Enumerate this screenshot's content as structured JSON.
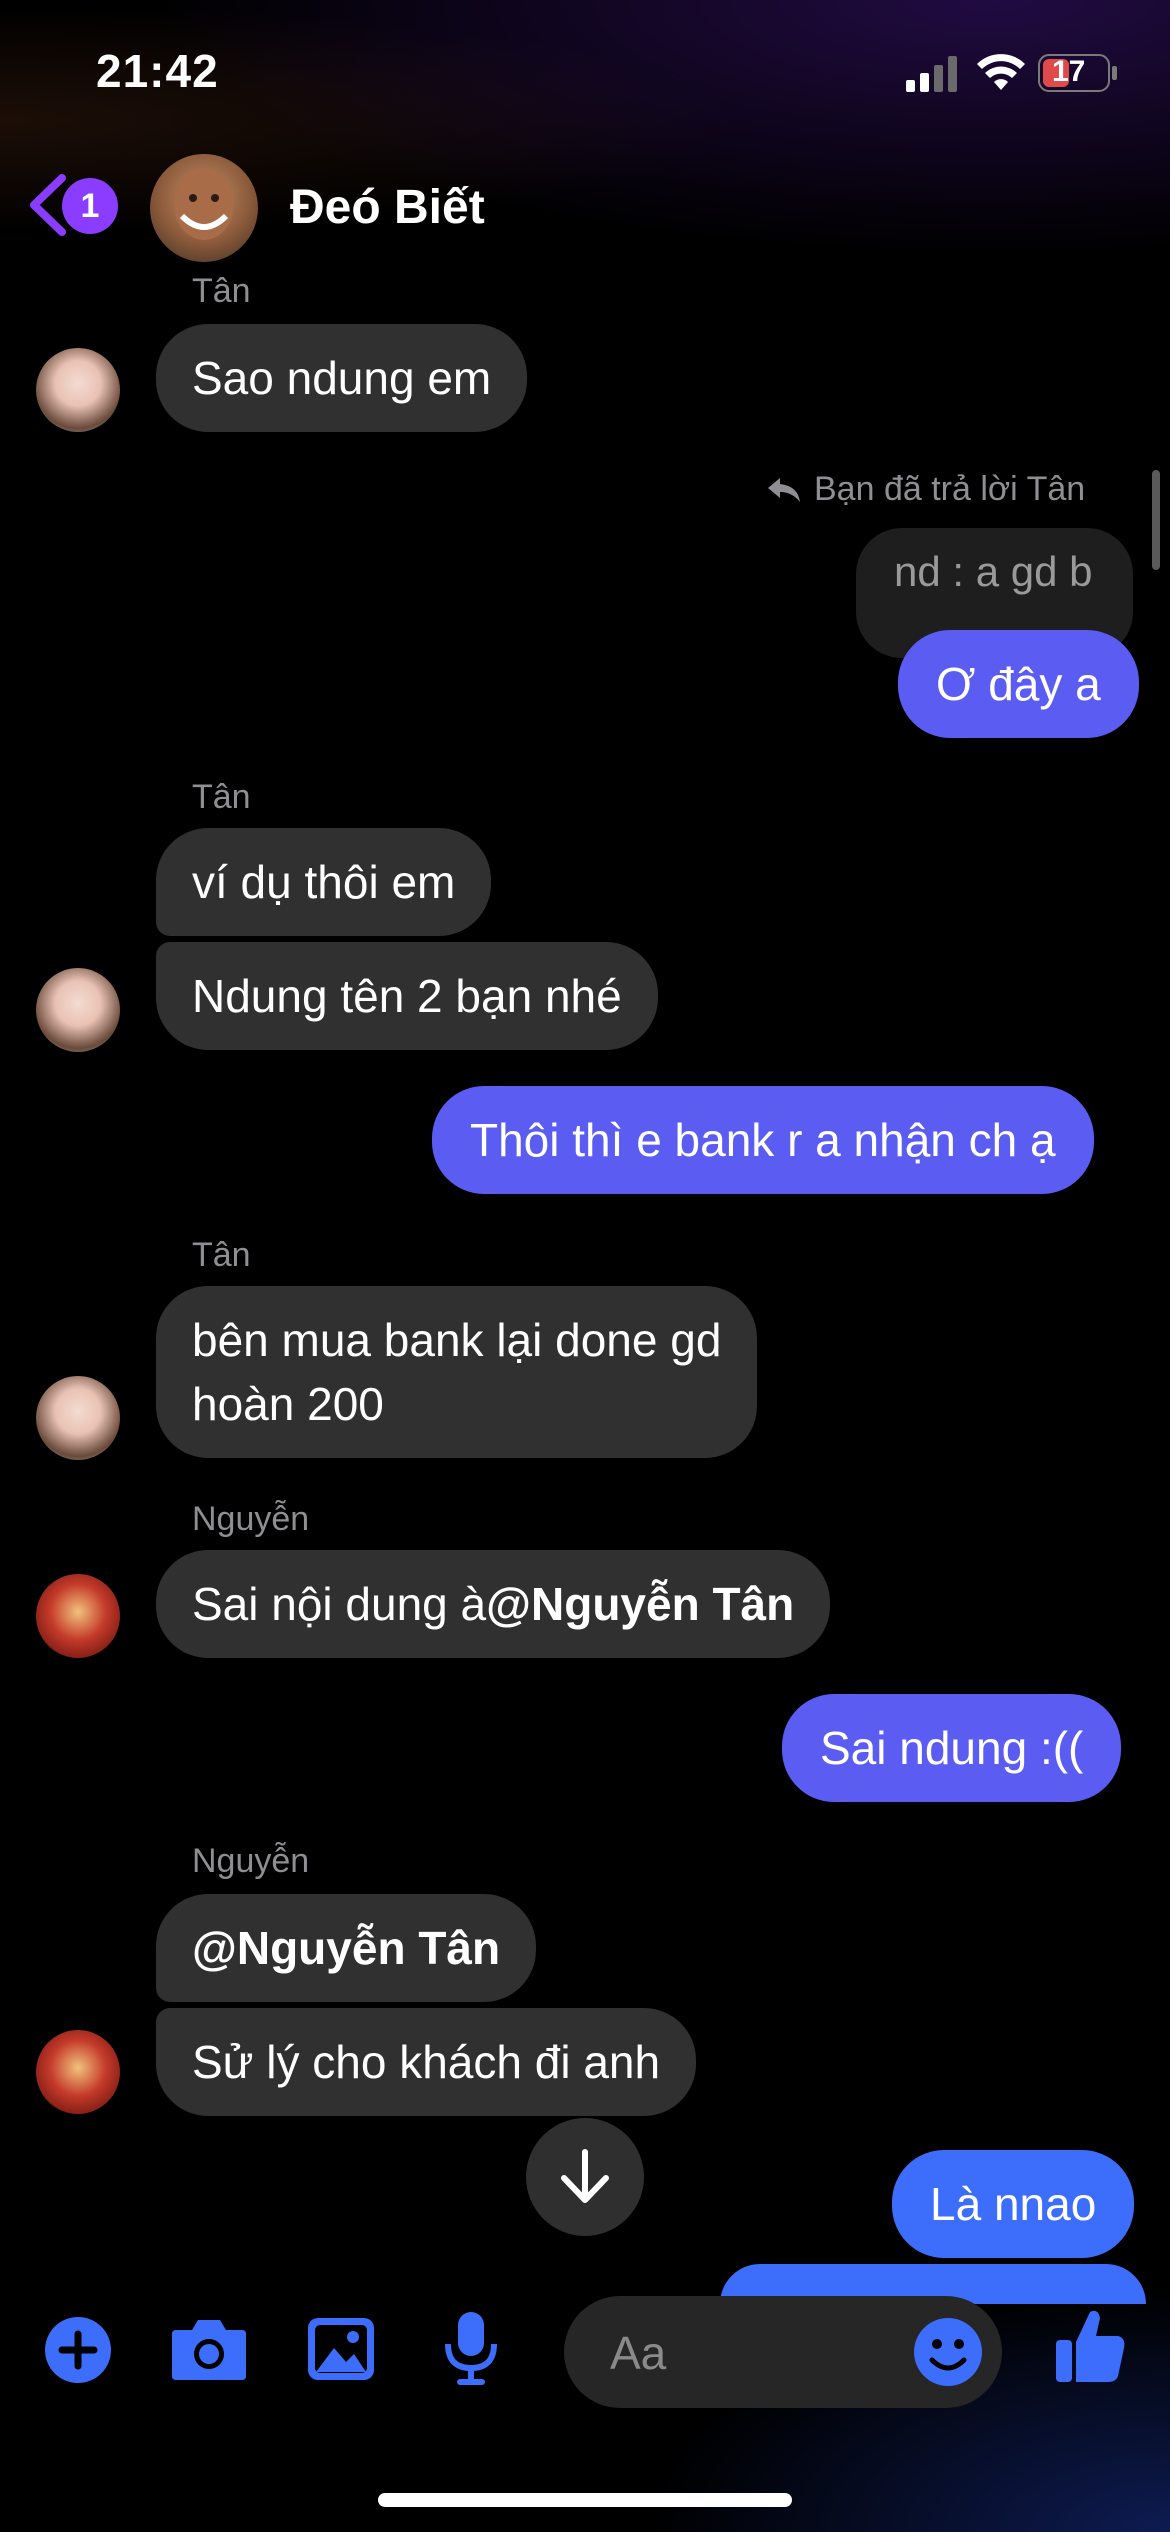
{
  "status_bar": {
    "time": "21:42",
    "battery": "17"
  },
  "header": {
    "unread_count": "1",
    "title": "Đeó Biết"
  },
  "messages": [
    {
      "sender": "Tân",
      "text": "Sao ndung em"
    },
    {
      "reply_indicator": "Bạn đã trả lời Tân",
      "quoted": "nd : a gd b",
      "text": "Ơ đây a"
    },
    {
      "sender": "Tân",
      "lines": [
        "ví dụ thôi em",
        "Ndung tên 2 bạn nhé"
      ]
    },
    {
      "text": "Thôi thì e bank r a nhận ch ạ"
    },
    {
      "sender": "Tân",
      "line1": "bên mua bank lại done gd",
      "line2": "hoàn 200"
    },
    {
      "sender": "Nguyễn",
      "text_plain": "Sai nội dung à",
      "mention": "@Nguyễn Tân"
    },
    {
      "text": "Sai ndung :(("
    },
    {
      "sender": "Nguyễn",
      "mention": "@Nguyễn Tân",
      "text": "Sử lý cho khách đi anh"
    },
    {
      "text": "Là nnao"
    }
  ],
  "composer": {
    "placeholder": "Aa"
  },
  "colors": {
    "accent": "#5b5df2",
    "badge": "#8a3dff",
    "icon_blue": "#3d6dfb",
    "incoming": "#303030"
  },
  "icons": [
    "back-chevron-icon",
    "plus-circle-icon",
    "camera-icon",
    "image-icon",
    "microphone-icon",
    "smiley-icon",
    "thumbs-up-icon",
    "arrow-down-icon",
    "reply-arrow-icon",
    "wifi-icon",
    "signal-icon",
    "battery-icon"
  ]
}
